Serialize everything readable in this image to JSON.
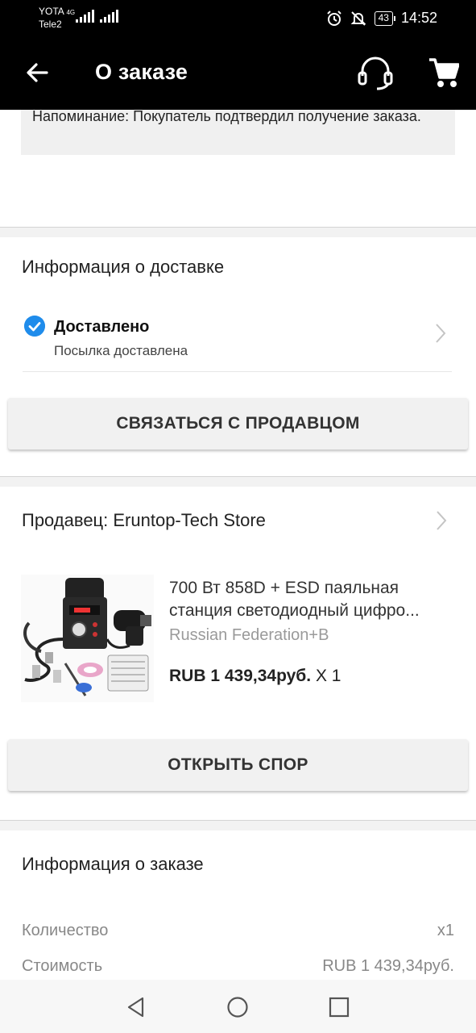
{
  "statusbar": {
    "carrier_top": "YOTA",
    "network": "4G",
    "carrier_bottom": "Tele2",
    "battery": "43",
    "time": "14:52"
  },
  "appbar": {
    "title": "О заказе"
  },
  "reminder": {
    "text": "Напоминание: Покупатель подтвердил получение заказа."
  },
  "delivery": {
    "section_title": "Информация о доставке",
    "status": "Доставлено",
    "status_sub": "Посылка доставлена",
    "contact_button": "СВЯЗАТЬСЯ С ПРОДАВЦОМ"
  },
  "seller": {
    "label": "Продавец: Eruntop-Tech Store"
  },
  "product": {
    "title_line1": "700 Вт 858D + ESD паяльная",
    "title_line2": "станция светодиодный цифро...",
    "variant": "Russian Federation+B",
    "price": "RUB 1 439,34руб.",
    "quantity": "X 1",
    "dispute_button": "ОТКРЫТЬ СПОР"
  },
  "order_info": {
    "section_title": "Информация о заказе",
    "rows": [
      {
        "label": "Количество",
        "value": "x1"
      },
      {
        "label": "Стоимость",
        "value": "RUB 1 439,34руб."
      }
    ]
  },
  "colors": {
    "accent": "#1f8ceb",
    "appbar": "#000000"
  }
}
